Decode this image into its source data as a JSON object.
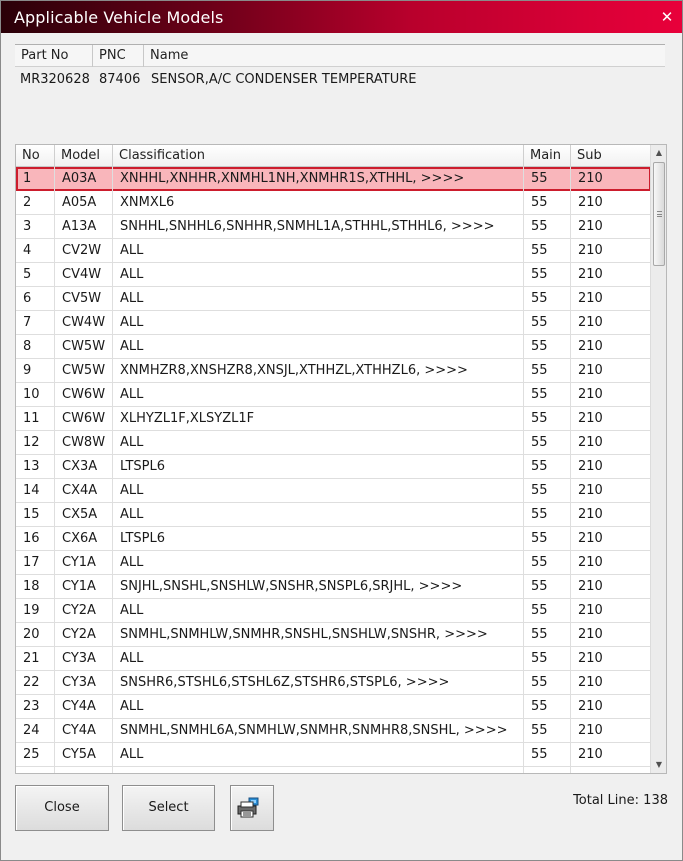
{
  "window": {
    "title": "Applicable Vehicle Models",
    "close_glyph": "✕"
  },
  "part": {
    "headers": [
      "Part No",
      "PNC",
      "Name"
    ],
    "part_no": "MR320628",
    "pnc": "87406",
    "name": "SENSOR,A/C CONDENSER TEMPERATURE"
  },
  "table": {
    "headers": [
      "No",
      "Model",
      "Classification",
      "Main",
      "Sub"
    ],
    "selected_row": 1,
    "rows": [
      {
        "no": "1",
        "model": "A03A",
        "classification": "XNHHL,XNHHR,XNMHL1NH,XNMHR1S,XTHHL,   >>>>",
        "main": "55",
        "sub": "210"
      },
      {
        "no": "2",
        "model": "A05A",
        "classification": "XNMXL6",
        "main": "55",
        "sub": "210"
      },
      {
        "no": "3",
        "model": "A13A",
        "classification": "SNHHL,SNHHL6,SNHHR,SNMHL1A,STHHL,STHHL6,   >>>>",
        "main": "55",
        "sub": "210"
      },
      {
        "no": "4",
        "model": "CV2W",
        "classification": "ALL",
        "main": "55",
        "sub": "210"
      },
      {
        "no": "5",
        "model": "CV4W",
        "classification": "ALL",
        "main": "55",
        "sub": "210"
      },
      {
        "no": "6",
        "model": "CV5W",
        "classification": "ALL",
        "main": "55",
        "sub": "210"
      },
      {
        "no": "7",
        "model": "CW4W",
        "classification": "ALL",
        "main": "55",
        "sub": "210"
      },
      {
        "no": "8",
        "model": "CW5W",
        "classification": "ALL",
        "main": "55",
        "sub": "210"
      },
      {
        "no": "9",
        "model": "CW5W",
        "classification": "XNMHZR8,XNSHZR8,XNSJL,XTHHZL,XTHHZL6,   >>>>",
        "main": "55",
        "sub": "210"
      },
      {
        "no": "10",
        "model": "CW6W",
        "classification": "ALL",
        "main": "55",
        "sub": "210"
      },
      {
        "no": "11",
        "model": "CW6W",
        "classification": "XLHYZL1F,XLSYZL1F",
        "main": "55",
        "sub": "210"
      },
      {
        "no": "12",
        "model": "CW8W",
        "classification": "ALL",
        "main": "55",
        "sub": "210"
      },
      {
        "no": "13",
        "model": "CX3A",
        "classification": "LTSPL6",
        "main": "55",
        "sub": "210"
      },
      {
        "no": "14",
        "model": "CX4A",
        "classification": "ALL",
        "main": "55",
        "sub": "210"
      },
      {
        "no": "15",
        "model": "CX5A",
        "classification": "ALL",
        "main": "55",
        "sub": "210"
      },
      {
        "no": "16",
        "model": "CX6A",
        "classification": "LTSPL6",
        "main": "55",
        "sub": "210"
      },
      {
        "no": "17",
        "model": "CY1A",
        "classification": "ALL",
        "main": "55",
        "sub": "210"
      },
      {
        "no": "18",
        "model": "CY1A",
        "classification": "SNJHL,SNSHL,SNSHLW,SNSHR,SNSPL6,SRJHL,   >>>>",
        "main": "55",
        "sub": "210"
      },
      {
        "no": "19",
        "model": "CY2A",
        "classification": "ALL",
        "main": "55",
        "sub": "210"
      },
      {
        "no": "20",
        "model": "CY2A",
        "classification": "SNMHL,SNMHLW,SNMHR,SNSHL,SNSHLW,SNSHR,   >>>>",
        "main": "55",
        "sub": "210"
      },
      {
        "no": "21",
        "model": "CY3A",
        "classification": "ALL",
        "main": "55",
        "sub": "210"
      },
      {
        "no": "22",
        "model": "CY3A",
        "classification": "SNSHR6,STSHL6,STSHL6Z,STSHR6,STSPL6,   >>>>",
        "main": "55",
        "sub": "210"
      },
      {
        "no": "23",
        "model": "CY4A",
        "classification": "ALL",
        "main": "55",
        "sub": "210"
      },
      {
        "no": "24",
        "model": "CY4A",
        "classification": "SNMHL,SNMHL6A,SNMHLW,SNMHR,SNMHR8,SNSHL,   >>>>",
        "main": "55",
        "sub": "210"
      },
      {
        "no": "25",
        "model": "CY5A",
        "classification": "ALL",
        "main": "55",
        "sub": "210"
      },
      {
        "no": "",
        "model": "",
        "classification": "",
        "main": "",
        "sub": ""
      }
    ]
  },
  "buttons": {
    "close_label": "Close",
    "select_label": "Select",
    "print_icon": "printer-icon"
  },
  "footer": {
    "total_label": "Total Line:",
    "total_value": "138"
  },
  "colors": {
    "title_gradient_end": "#e8003a",
    "selected_fill": "#f9b6bb",
    "selected_border": "#cc1d2d"
  }
}
